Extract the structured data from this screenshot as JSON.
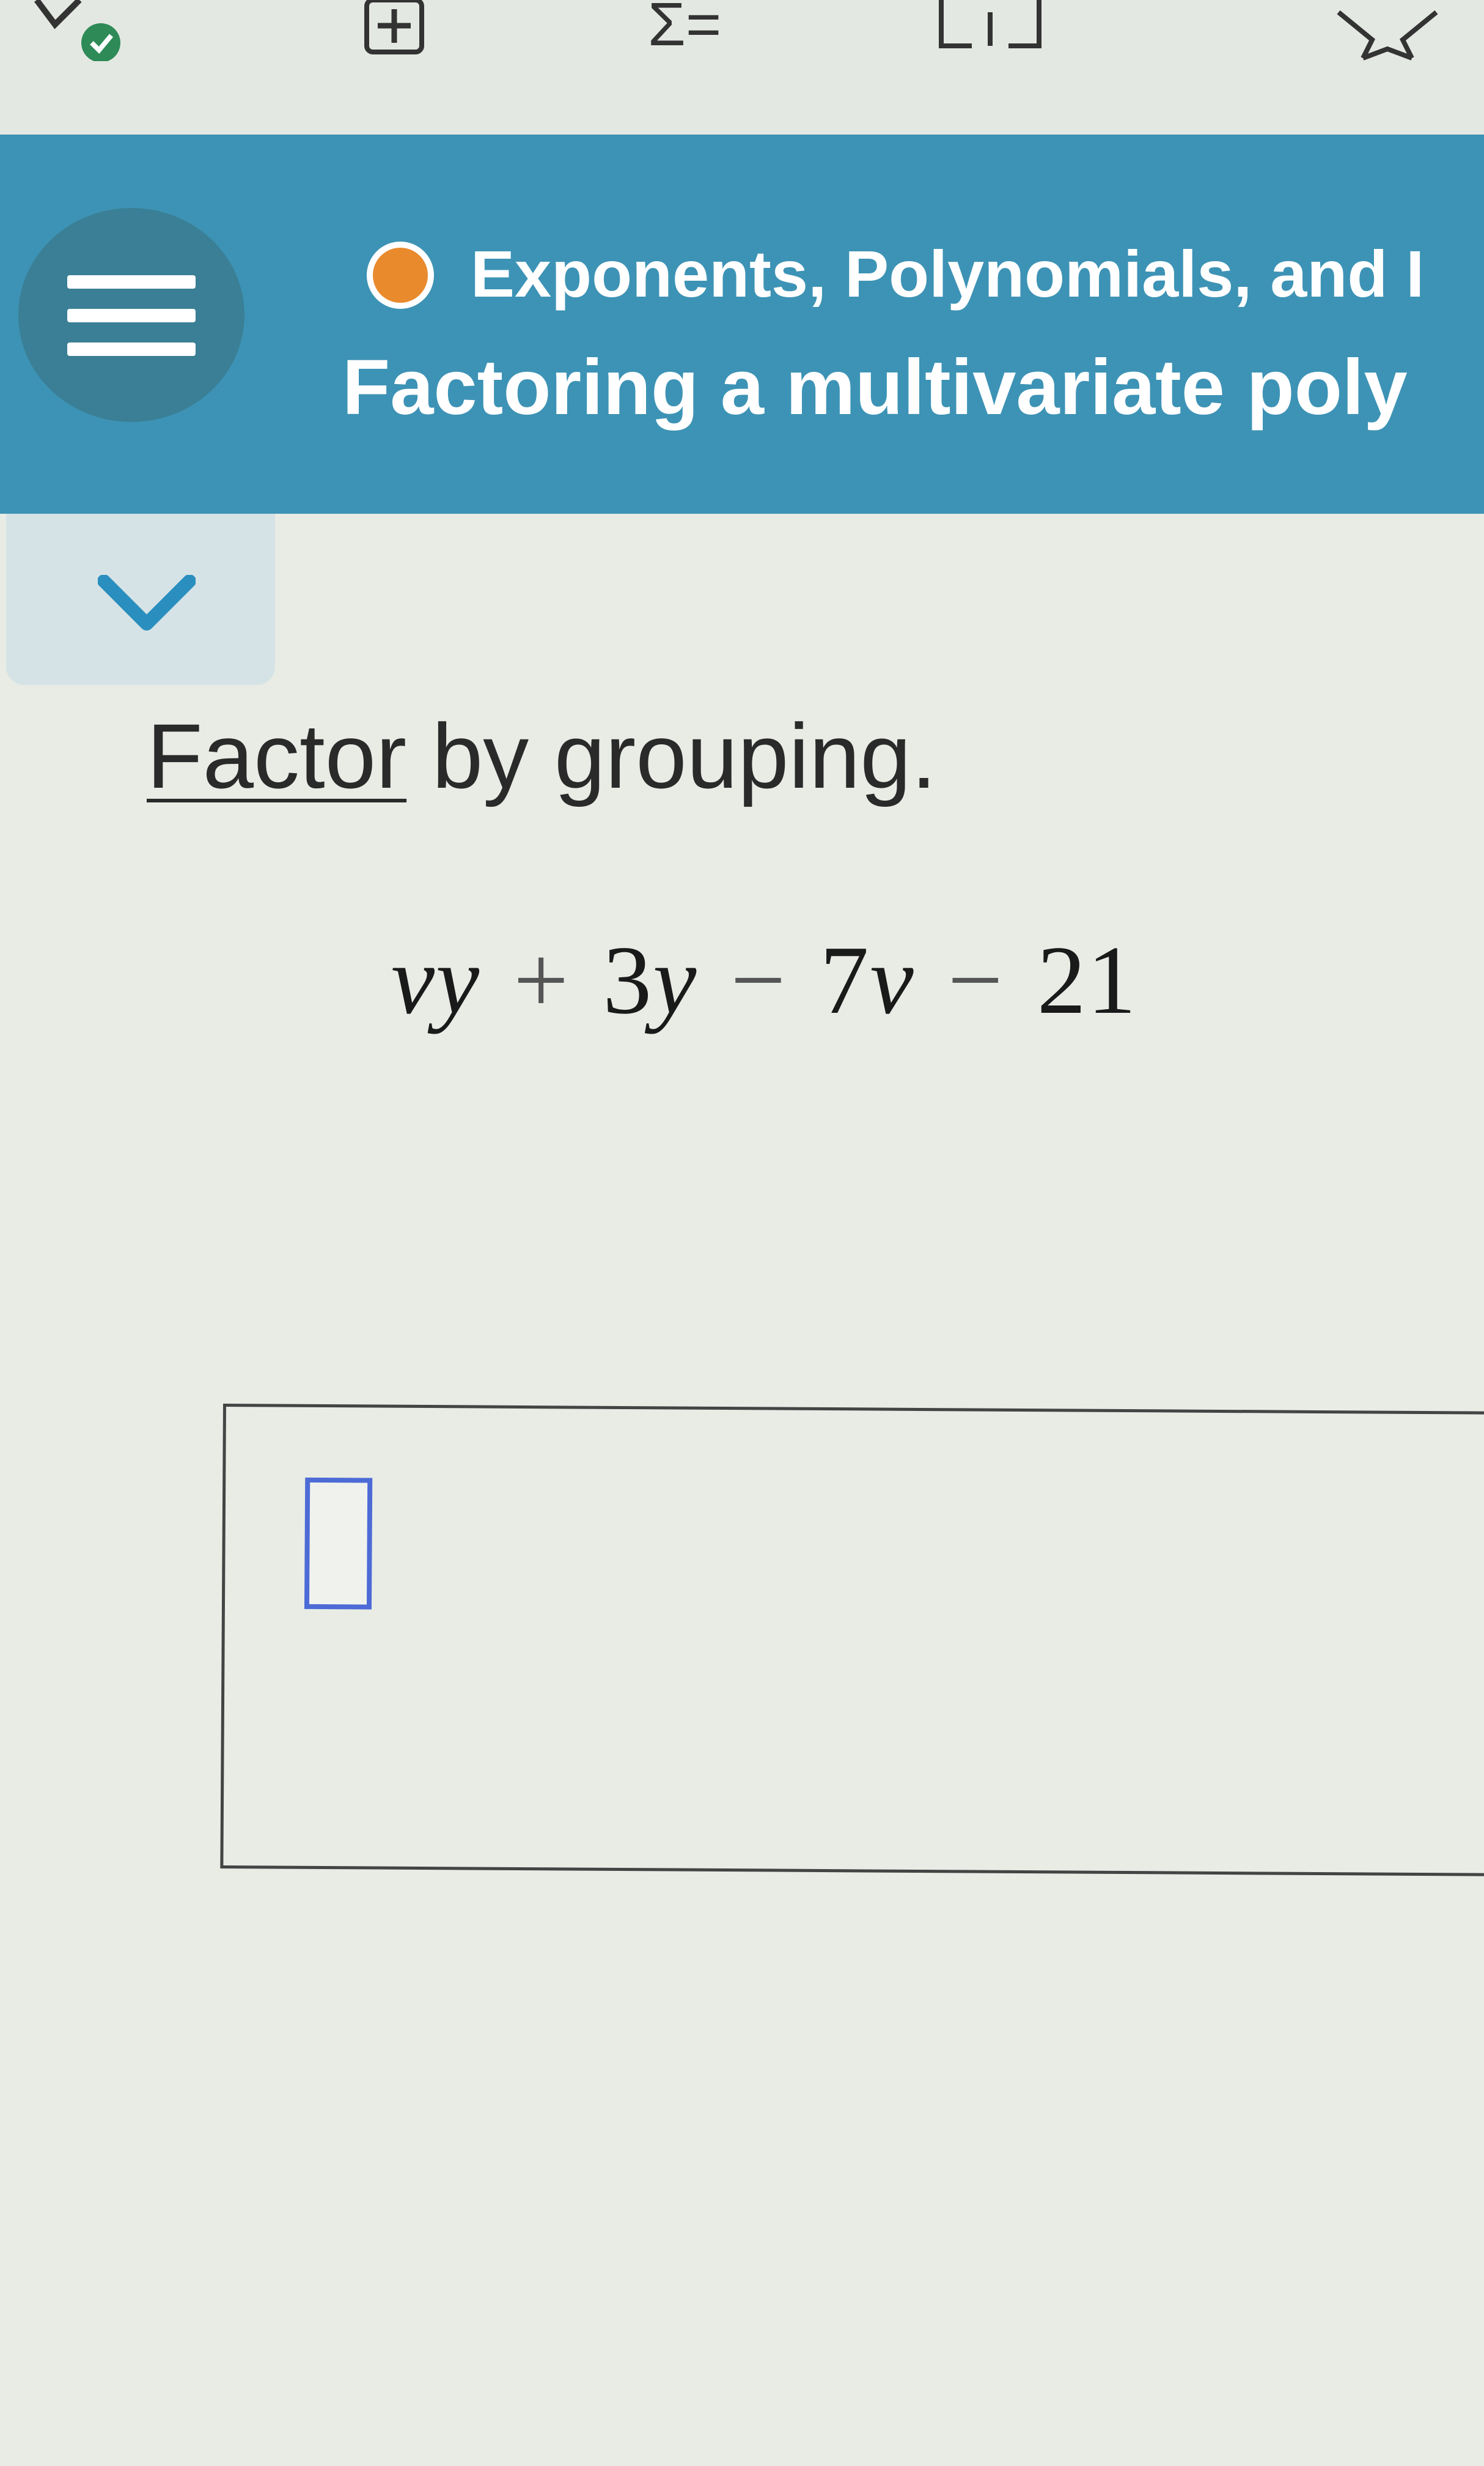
{
  "toolbar": {
    "icons": [
      "check-badge-icon",
      "add-box-icon",
      "sum-list-icon",
      "bracket-icon",
      "star-icon"
    ],
    "sum_symbol": "Σ="
  },
  "header": {
    "topic": "Exponents, Polynomials, and I",
    "lesson_title": "Factoring a multivariate poly",
    "colors": {
      "band": "#3d93b5",
      "menu_circle": "#3a7f95",
      "topic_dot": "#e98a2d"
    }
  },
  "question": {
    "prompt_link": "Factor",
    "prompt_rest": " by grouping.",
    "expression": {
      "t1": "vy",
      "op1": "+",
      "t2_coef": "3",
      "t2_var": "y",
      "op2": "−",
      "t3_coef": "7",
      "t3_var": "v",
      "op3": "−",
      "t4": "21"
    }
  },
  "answer": {
    "input_value": ""
  }
}
